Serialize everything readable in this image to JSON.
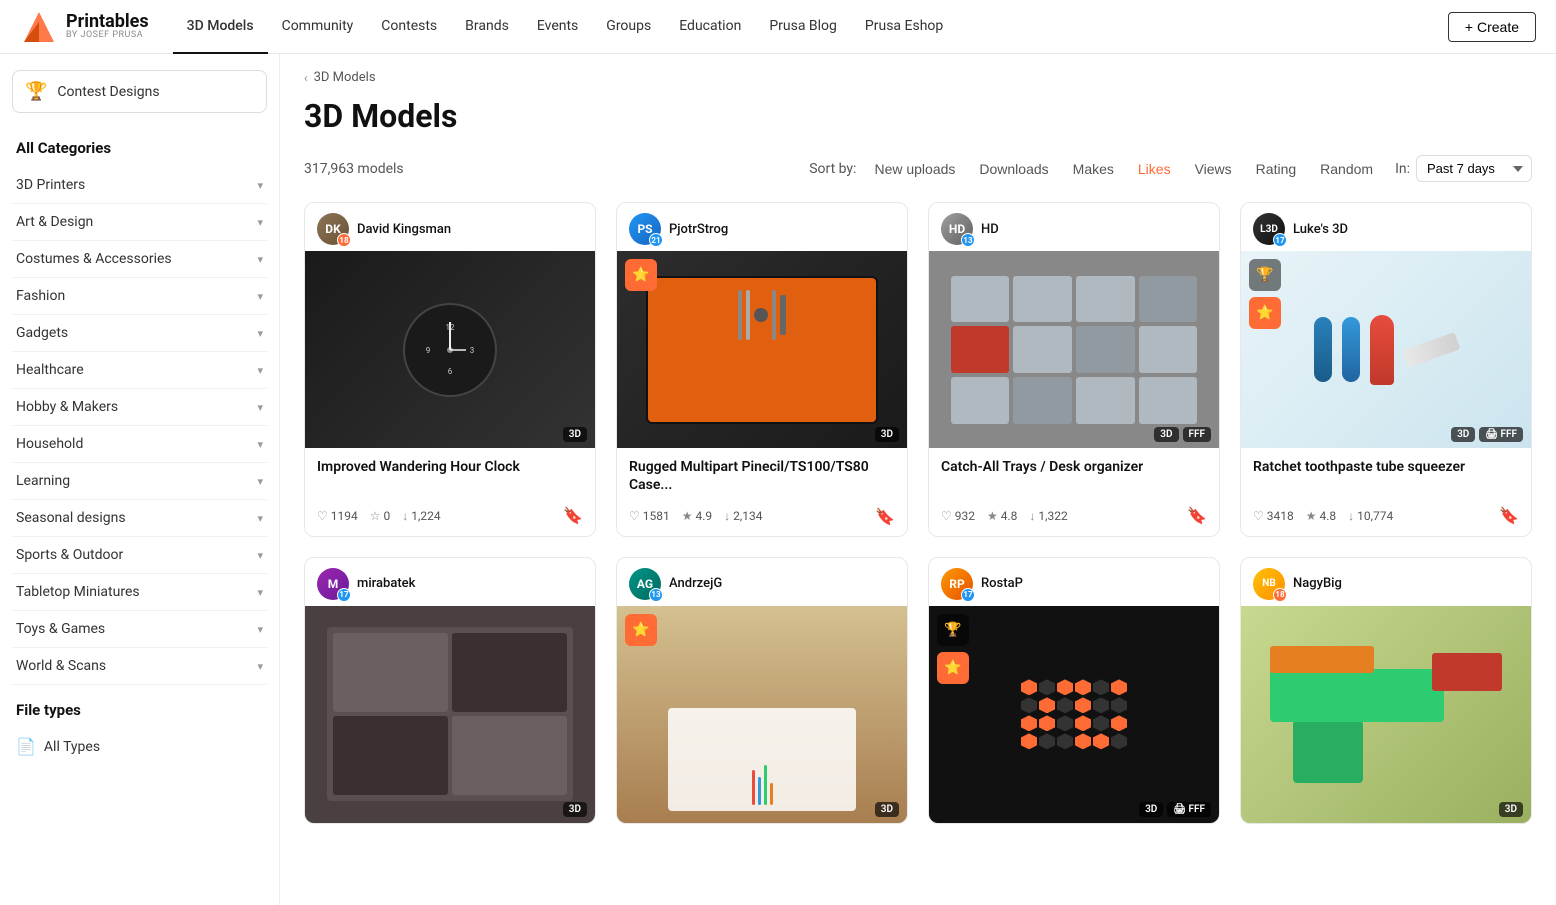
{
  "header": {
    "logo_main": "Printables",
    "logo_sub": "BY JOSEF PRUSA",
    "nav_items": [
      {
        "label": "3D Models",
        "active": true
      },
      {
        "label": "Community",
        "active": false
      },
      {
        "label": "Contests",
        "active": false
      },
      {
        "label": "Brands",
        "active": false
      },
      {
        "label": "Events",
        "active": false
      },
      {
        "label": "Groups",
        "active": false
      },
      {
        "label": "Education",
        "active": false
      },
      {
        "label": "Prusa Blog",
        "active": false
      },
      {
        "label": "Prusa Eshop",
        "active": false
      }
    ],
    "create_btn": "+ Create"
  },
  "sidebar": {
    "contest_label": "Contest Designs",
    "all_categories": "All Categories",
    "categories": [
      {
        "label": "3D Printers"
      },
      {
        "label": "Art & Design"
      },
      {
        "label": "Costumes & Accessories"
      },
      {
        "label": "Fashion"
      },
      {
        "label": "Gadgets"
      },
      {
        "label": "Healthcare"
      },
      {
        "label": "Hobby & Makers"
      },
      {
        "label": "Household"
      },
      {
        "label": "Learning"
      },
      {
        "label": "Seasonal designs"
      },
      {
        "label": "Sports & Outdoor"
      },
      {
        "label": "Tabletop Miniatures"
      },
      {
        "label": "Toys & Games"
      },
      {
        "label": "World & Scans"
      }
    ],
    "file_types_label": "File types",
    "all_types_label": "All Types"
  },
  "content": {
    "breadcrumb": "3D Models",
    "page_title": "3D Models",
    "model_count": "317,963 models",
    "sort_label": "Sort by:",
    "sort_options": [
      {
        "label": "New uploads",
        "active": false
      },
      {
        "label": "Downloads",
        "active": false
      },
      {
        "label": "Makes",
        "active": false
      },
      {
        "label": "Likes",
        "active": true
      },
      {
        "label": "Views",
        "active": false
      },
      {
        "label": "Rating",
        "active": false
      },
      {
        "label": "Random",
        "active": false
      }
    ],
    "in_label": "In:",
    "period": "Past 7 days",
    "models": [
      {
        "user": "David Kingsman",
        "badge_num": "18",
        "badge_color": "orange",
        "title": "Improved Wandering Hour Clock",
        "likes": "1194",
        "stars": "",
        "downloads": "1,224",
        "badges": [
          "3D"
        ],
        "img_type": "clock",
        "has_star": false,
        "has_trophy": false
      },
      {
        "user": "PjotrStrog",
        "badge_num": "21",
        "badge_color": "blue",
        "title": "Rugged Multipart Pinecil/TS100/TS80 Case...",
        "likes": "1581",
        "stars": "4.9",
        "downloads": "2,134",
        "badges": [
          "3D"
        ],
        "img_type": "toolcase",
        "has_star": true,
        "has_trophy": false
      },
      {
        "user": "HD",
        "badge_num": "13",
        "badge_color": "blue",
        "title": "Catch-All Trays / Desk organizer",
        "likes": "932",
        "stars": "4.8",
        "downloads": "1,322",
        "badges": [
          "3D",
          "FFF"
        ],
        "img_type": "trays",
        "has_star": false,
        "has_trophy": false
      },
      {
        "user": "Luke's 3D",
        "badge_num": "17",
        "badge_color": "blue",
        "title": "Ratchet toothpaste tube squeezer",
        "likes": "3418",
        "stars": "4.8",
        "downloads": "10,774",
        "badges": [
          "3D",
          "FFF"
        ],
        "img_type": "toothpaste",
        "has_star": true,
        "has_trophy": true
      },
      {
        "user": "mirabatek",
        "badge_num": "17",
        "badge_color": "blue",
        "title": "",
        "likes": "",
        "stars": "",
        "downloads": "",
        "badges": [
          "3D"
        ],
        "img_type": "workshop",
        "has_star": false,
        "has_trophy": false
      },
      {
        "user": "AndrzejG",
        "badge_num": "13",
        "badge_color": "blue",
        "title": "",
        "likes": "",
        "stars": "",
        "downloads": "",
        "badges": [
          "3D"
        ],
        "img_type": "desk",
        "has_star": true,
        "has_trophy": false
      },
      {
        "user": "RostaP",
        "badge_num": "17",
        "badge_color": "blue",
        "title": "",
        "likes": "",
        "stars": "",
        "downloads": "",
        "badges": [
          "3D",
          "FFF"
        ],
        "img_type": "hex",
        "has_star": false,
        "has_trophy": true
      },
      {
        "user": "NagyBig",
        "badge_num": "18",
        "badge_color": "orange",
        "title": "",
        "likes": "",
        "stars": "",
        "downloads": "",
        "badges": [
          "3D"
        ],
        "img_type": "gun",
        "has_star": false,
        "has_trophy": false
      }
    ]
  }
}
